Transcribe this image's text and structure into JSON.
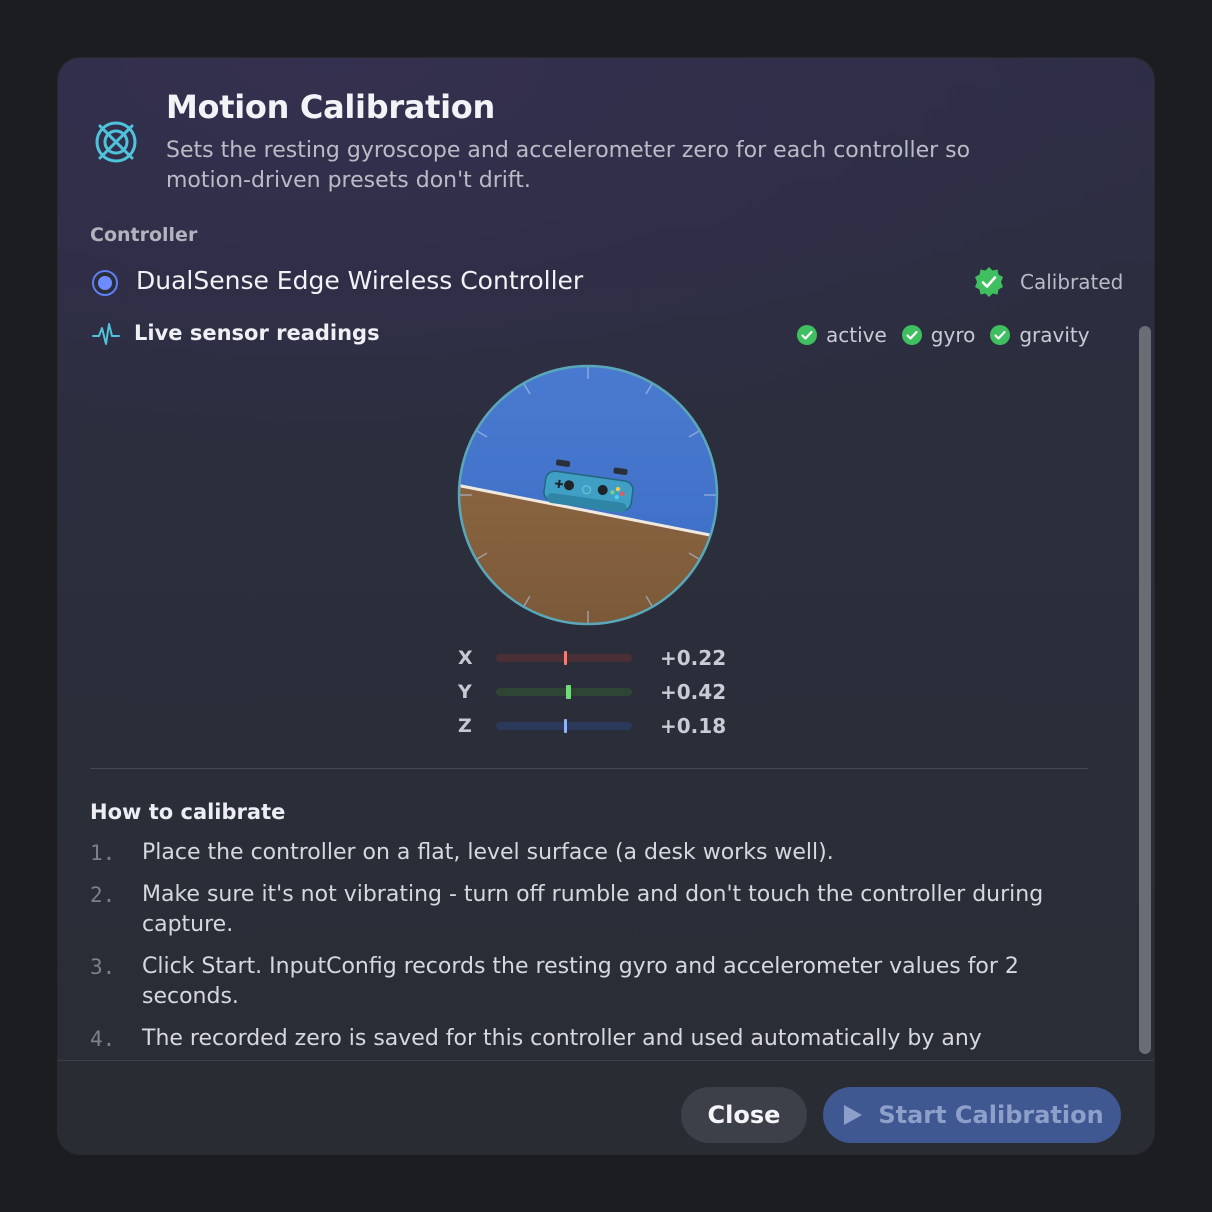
{
  "dialog": {
    "title": "Motion Calibration",
    "subtitle": "Sets the resting gyroscope and accelerometer zero for each controller so motion-driven presets don't drift.",
    "icon": "motion-target-icon",
    "accent": "#4fc3d9"
  },
  "controller": {
    "section_label": "Controller",
    "name": "DualSense Edge Wireless Controller",
    "selected": true,
    "status_label": "Calibrated",
    "status_color": "#3fbf5f"
  },
  "sensors": {
    "title": "Live sensor readings",
    "icon": "pulse-icon",
    "flags": [
      {
        "label": "active"
      },
      {
        "label": "gyro"
      },
      {
        "label": "gravity"
      }
    ],
    "axes": [
      {
        "label": "X",
        "value": "+0.22",
        "level": 0.51,
        "color": "#ff7a6e",
        "track": "#4a3036"
      },
      {
        "label": "Y",
        "value": "+0.42",
        "level": 0.53,
        "color": "#6fdc7a",
        "track": "#2e4536"
      },
      {
        "label": "Z",
        "value": "+0.18",
        "level": 0.51,
        "color": "#8fb4ff",
        "track": "#2b3a5a"
      }
    ]
  },
  "instructions": {
    "title": "How to calibrate",
    "steps": [
      {
        "num": "1.",
        "text": "Place the controller on a flat, level surface (a desk works well)."
      },
      {
        "num": "2.",
        "text": "Make sure it's not vibrating - turn off rumble and don't touch the controller during capture."
      },
      {
        "num": "3.",
        "text": "Click Start. InputConfig records the resting gyro and accelerometer values for 2 seconds."
      },
      {
        "num": "4.",
        "text": "The recorded zero is saved for this controller and used automatically by any"
      }
    ]
  },
  "footer": {
    "close_label": "Close",
    "start_label": "Start Calibration"
  }
}
